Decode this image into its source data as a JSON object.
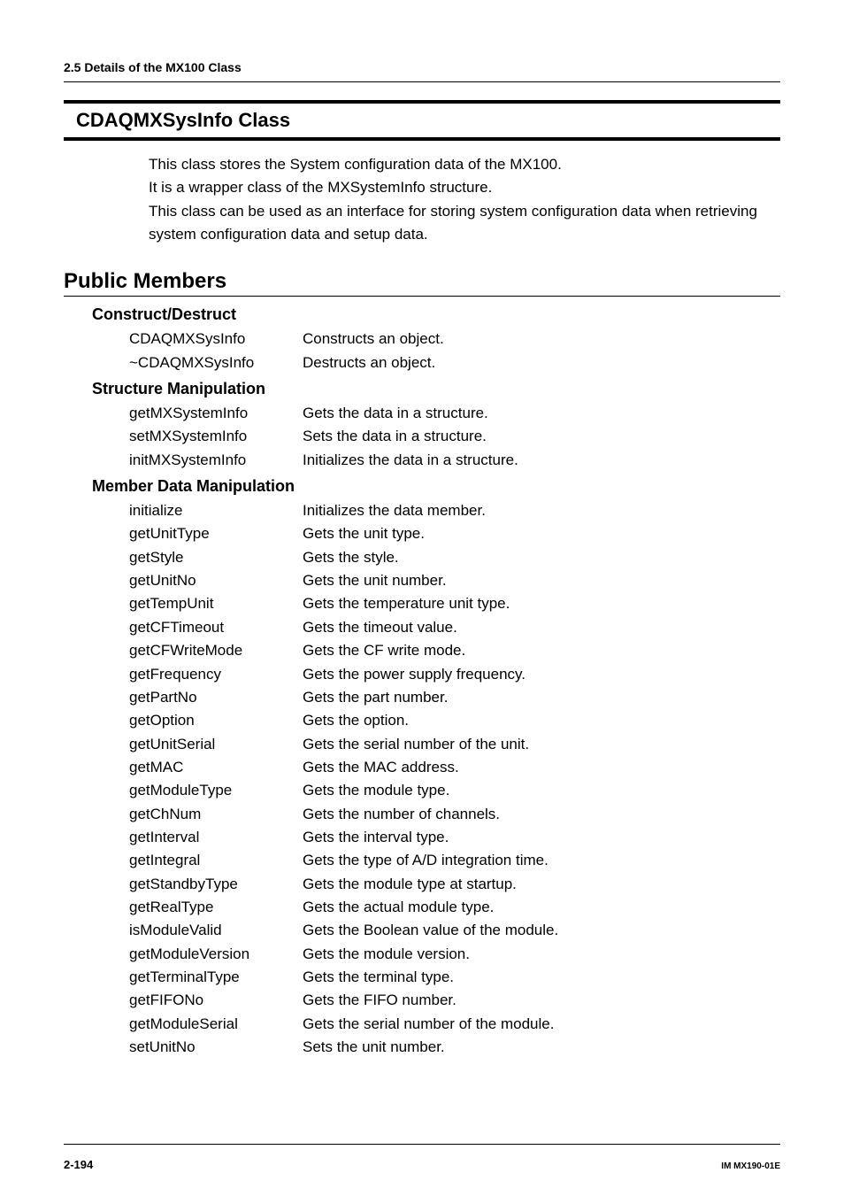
{
  "runningHead": "2.5  Details of the MX100 Class",
  "title": "CDAQMXSysInfo Class",
  "intro": [
    "This class stores the System configuration data of the MX100.",
    "It is a wrapper class of the MXSystemInfo structure.",
    "This class can be used as an interface for storing system configuration data when retrieving system configuration data and setup data."
  ],
  "publicMembersHeading": "Public Members",
  "sections": [
    {
      "heading": "Construct/Destruct",
      "items": [
        {
          "term": "CDAQMXSysInfo",
          "desc": "Constructs an object."
        },
        {
          "term": "~CDAQMXSysInfo",
          "desc": "Destructs an object."
        }
      ]
    },
    {
      "heading": "Structure Manipulation",
      "items": [
        {
          "term": "getMXSystemInfo",
          "desc": "Gets the data in a structure."
        },
        {
          "term": "setMXSystemInfo",
          "desc": "Sets the data in a structure."
        },
        {
          "term": "initMXSystemInfo",
          "desc": "Initializes the data in a structure."
        }
      ]
    },
    {
      "heading": "Member Data Manipulation",
      "items": [
        {
          "term": "initialize",
          "desc": "Initializes the data member."
        },
        {
          "term": "getUnitType",
          "desc": "Gets the unit type."
        },
        {
          "term": "getStyle",
          "desc": "Gets the style."
        },
        {
          "term": "getUnitNo",
          "desc": "Gets the unit number."
        },
        {
          "term": "getTempUnit",
          "desc": "Gets the temperature unit type."
        },
        {
          "term": "getCFTimeout",
          "desc": "Gets the timeout value."
        },
        {
          "term": "getCFWriteMode",
          "desc": "Gets the CF write mode."
        },
        {
          "term": "getFrequency",
          "desc": "Gets the power supply frequency."
        },
        {
          "term": "getPartNo",
          "desc": "Gets the part number."
        },
        {
          "term": "getOption",
          "desc": "Gets the option."
        },
        {
          "term": "getUnitSerial",
          "desc": "Gets the serial number of the unit."
        },
        {
          "term": "getMAC",
          "desc": "Gets the MAC address."
        },
        {
          "term": "getModuleType",
          "desc": "Gets the module type."
        },
        {
          "term": "getChNum",
          "desc": "Gets the number of channels."
        },
        {
          "term": "getInterval",
          "desc": "Gets the interval type."
        },
        {
          "term": "getIntegral",
          "desc": "Gets the type of A/D integration time."
        },
        {
          "term": "getStandbyType",
          "desc": "Gets the module type at startup."
        },
        {
          "term": "getRealType",
          "desc": "Gets the actual module type."
        },
        {
          "term": "isModuleValid",
          "desc": "Gets the Boolean value of the module."
        },
        {
          "term": "getModuleVersion",
          "desc": "Gets the module version."
        },
        {
          "term": "getTerminalType",
          "desc": "Gets the terminal type."
        },
        {
          "term": "getFIFONo",
          "desc": "Gets the FIFO number."
        },
        {
          "term": "getModuleSerial",
          "desc": "Gets the serial number of the module."
        },
        {
          "term": "setUnitNo",
          "desc": "Sets the unit number."
        }
      ]
    }
  ],
  "pageNumber": "2-194",
  "docId": "IM MX190-01E"
}
